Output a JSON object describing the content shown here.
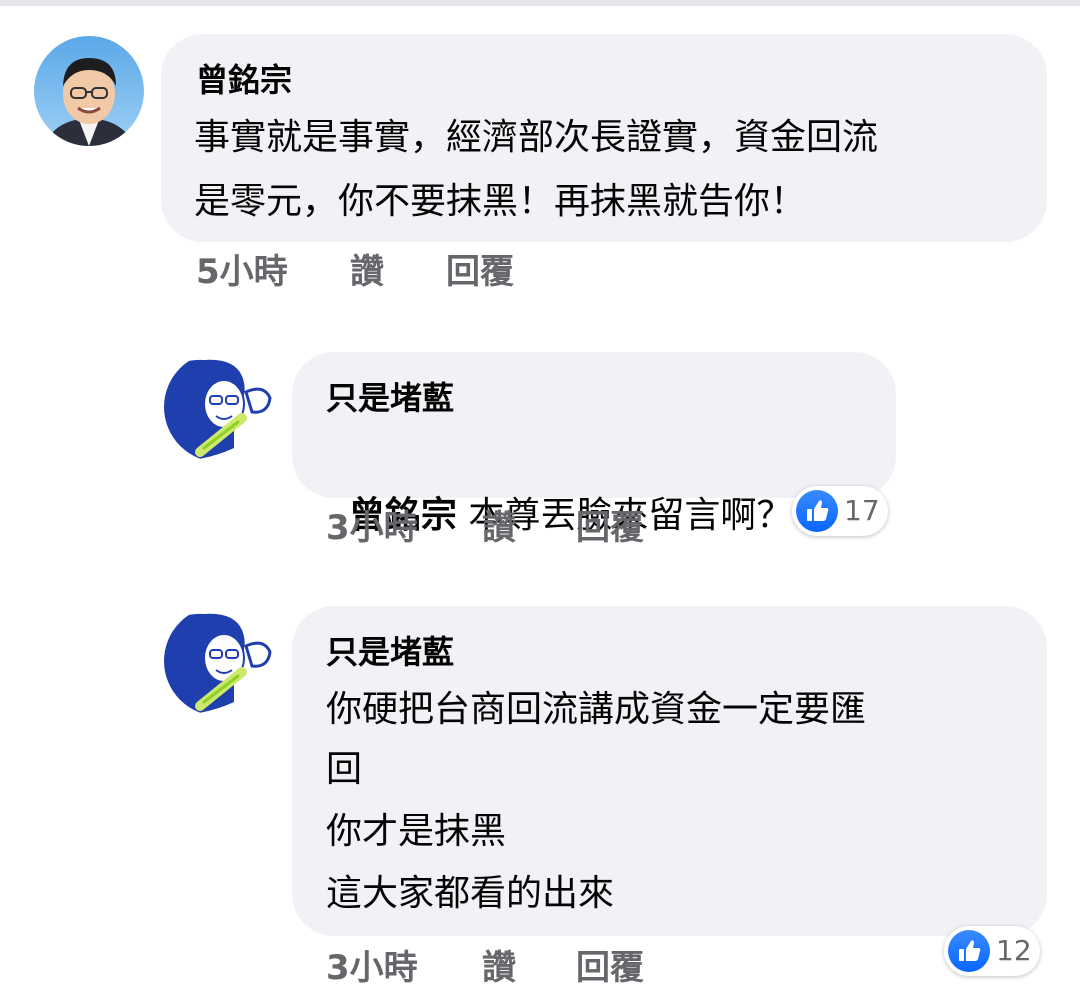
{
  "colors": {
    "bubble": "#f0f2f5",
    "secondary_text": "#65676b",
    "like_blue": "#0866ff"
  },
  "comments": [
    {
      "author": "曾銘宗",
      "avatar_icon": "politician-photo-avatar",
      "lines": [
        "事實就是事實，經濟部次長證實，資金回流",
        "是零元，你不要抹黑！再抹黑就告你！"
      ],
      "time": "5小時",
      "like_label": "讚",
      "reply_label": "回覆"
    },
    {
      "author": "只是堵藍",
      "avatar_icon": "cartoon-woman-avatar",
      "mention": "曾銘宗",
      "lines": [
        " 本尊丟臉來留言啊？"
      ],
      "time": "3小時",
      "like_label": "讚",
      "reply_label": "回覆",
      "reaction_icon": "thumbs-up-icon",
      "reaction_count": "17"
    },
    {
      "author": "只是堵藍",
      "avatar_icon": "cartoon-woman-avatar",
      "lines": [
        "你硬把台商回流講成資金一定要匯",
        "回",
        "你才是抹黑",
        "這大家都看的出來"
      ],
      "time": "3小時",
      "like_label": "讚",
      "reply_label": "回覆",
      "reaction_icon": "thumbs-up-icon",
      "reaction_count": "12"
    }
  ]
}
